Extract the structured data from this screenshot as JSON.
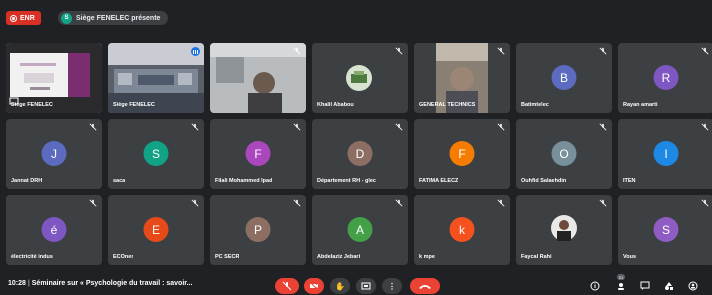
{
  "top": {
    "record_label": "ENR",
    "presenting_initial": "S",
    "presenting_text": "Siège FENELEC présente"
  },
  "tiles": [
    {
      "name": "Siège FENELEC",
      "kind": "screen"
    },
    {
      "name": "Siège FENELEC",
      "kind": "room"
    },
    {
      "name": "",
      "kind": "camera"
    },
    {
      "name": "Khalil Ababou",
      "kind": "photo"
    },
    {
      "name": "GENERAL TECHNICS",
      "kind": "camera2"
    },
    {
      "name": "Batimtelec",
      "initial": "B",
      "color": "#5c6bc0"
    },
    {
      "name": "Rayan amarti",
      "initial": "R",
      "color": "#7e57c2"
    },
    {
      "name": "Jannat DRH",
      "initial": "J",
      "color": "#5c6bc0"
    },
    {
      "name": "saca",
      "initial": "S",
      "color": "#12a387"
    },
    {
      "name": "Filali Mohammed Ipad",
      "initial": "F",
      "color": "#ab47bc"
    },
    {
      "name": "Département RH - glec",
      "initial": "D",
      "color": "#8d6e63"
    },
    {
      "name": "FATIMA ELECZ",
      "initial": "F",
      "color": "#f57c00"
    },
    {
      "name": "Ouhfid Salaehdin",
      "initial": "O",
      "color": "#78909c"
    },
    {
      "name": "ITEN",
      "initial": "I",
      "color": "#1e88e5"
    },
    {
      "name": "électricité indus",
      "initial": "é",
      "color": "#7e57c2"
    },
    {
      "name": "ECOner",
      "initial": "E",
      "color": "#e64a19"
    },
    {
      "name": "PC SECR",
      "initial": "P",
      "color": "#8d6e63"
    },
    {
      "name": "Abdelaziz Jebari",
      "initial": "A",
      "color": "#43a047"
    },
    {
      "name": "k mpe",
      "initial": "k",
      "color": "#f4511e"
    },
    {
      "name": "Faycal Rahi",
      "kind": "portrait"
    },
    {
      "name": "Vous",
      "initial": "S",
      "color": "#8e5cc2"
    }
  ],
  "bottom": {
    "time": "10:28",
    "meeting_title": "Séminaire sur « Psychologie du travail : savoir...",
    "participants_count": "21"
  },
  "colors": {
    "background": "#202124",
    "tile": "#3c4043",
    "danger": "#ea4335"
  }
}
